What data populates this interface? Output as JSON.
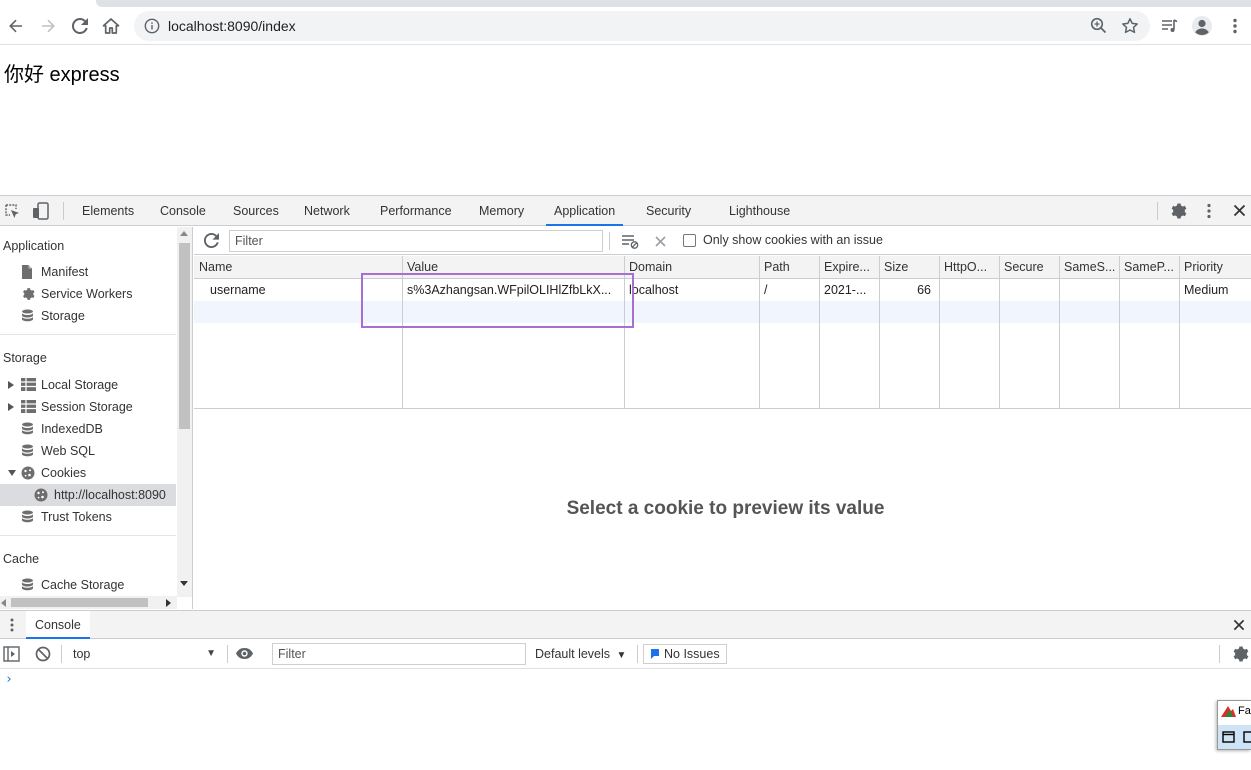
{
  "browser": {
    "url": "localhost:8090/index"
  },
  "page": {
    "greeting": "你好 express"
  },
  "devtools": {
    "tabs": [
      {
        "label": "Elements"
      },
      {
        "label": "Console"
      },
      {
        "label": "Sources"
      },
      {
        "label": "Network"
      },
      {
        "label": "Performance"
      },
      {
        "label": "Memory"
      },
      {
        "label": "Application",
        "active": true
      },
      {
        "label": "Security"
      },
      {
        "label": "Lighthouse"
      }
    ],
    "sidebar": {
      "application_title": "Application",
      "application_items": [
        "Manifest",
        "Service Workers",
        "Storage"
      ],
      "storage_title": "Storage",
      "storage_items": [
        "Local Storage",
        "Session Storage",
        "IndexedDB",
        "Web SQL",
        "Cookies",
        "http://localhost:8090",
        "Trust Tokens"
      ],
      "cache_title": "Cache",
      "cache_items": [
        "Cache Storage"
      ]
    },
    "cookies": {
      "filter_placeholder": "Filter",
      "only_issue_label": "Only show cookies with an issue",
      "columns": [
        "Name",
        "Value",
        "Domain",
        "Path",
        "Expire...",
        "Size",
        "HttpO...",
        "Secure",
        "SameS...",
        "SameP...",
        "Priority"
      ],
      "rows": [
        {
          "name": "username",
          "value": "s%3Azhangsan.WFpilOLIHlZfbLkX...",
          "domain": "localhost",
          "path": "/",
          "expires": "2021-...",
          "size": "66",
          "httponly": "",
          "secure": "",
          "samesite": "",
          "sameparty": "",
          "priority": "Medium"
        }
      ],
      "preview_message": "Select a cookie to preview its value"
    },
    "drawer": {
      "tab_label": "Console",
      "context": "top",
      "filter_placeholder": "Filter",
      "levels_label": "Default levels",
      "issues_label": "No Issues",
      "prompt": "›"
    }
  },
  "corner_window": {
    "label": "Fa"
  },
  "colors": {
    "accent": "#1a73e8",
    "highlight_box": "#a56fd3"
  }
}
